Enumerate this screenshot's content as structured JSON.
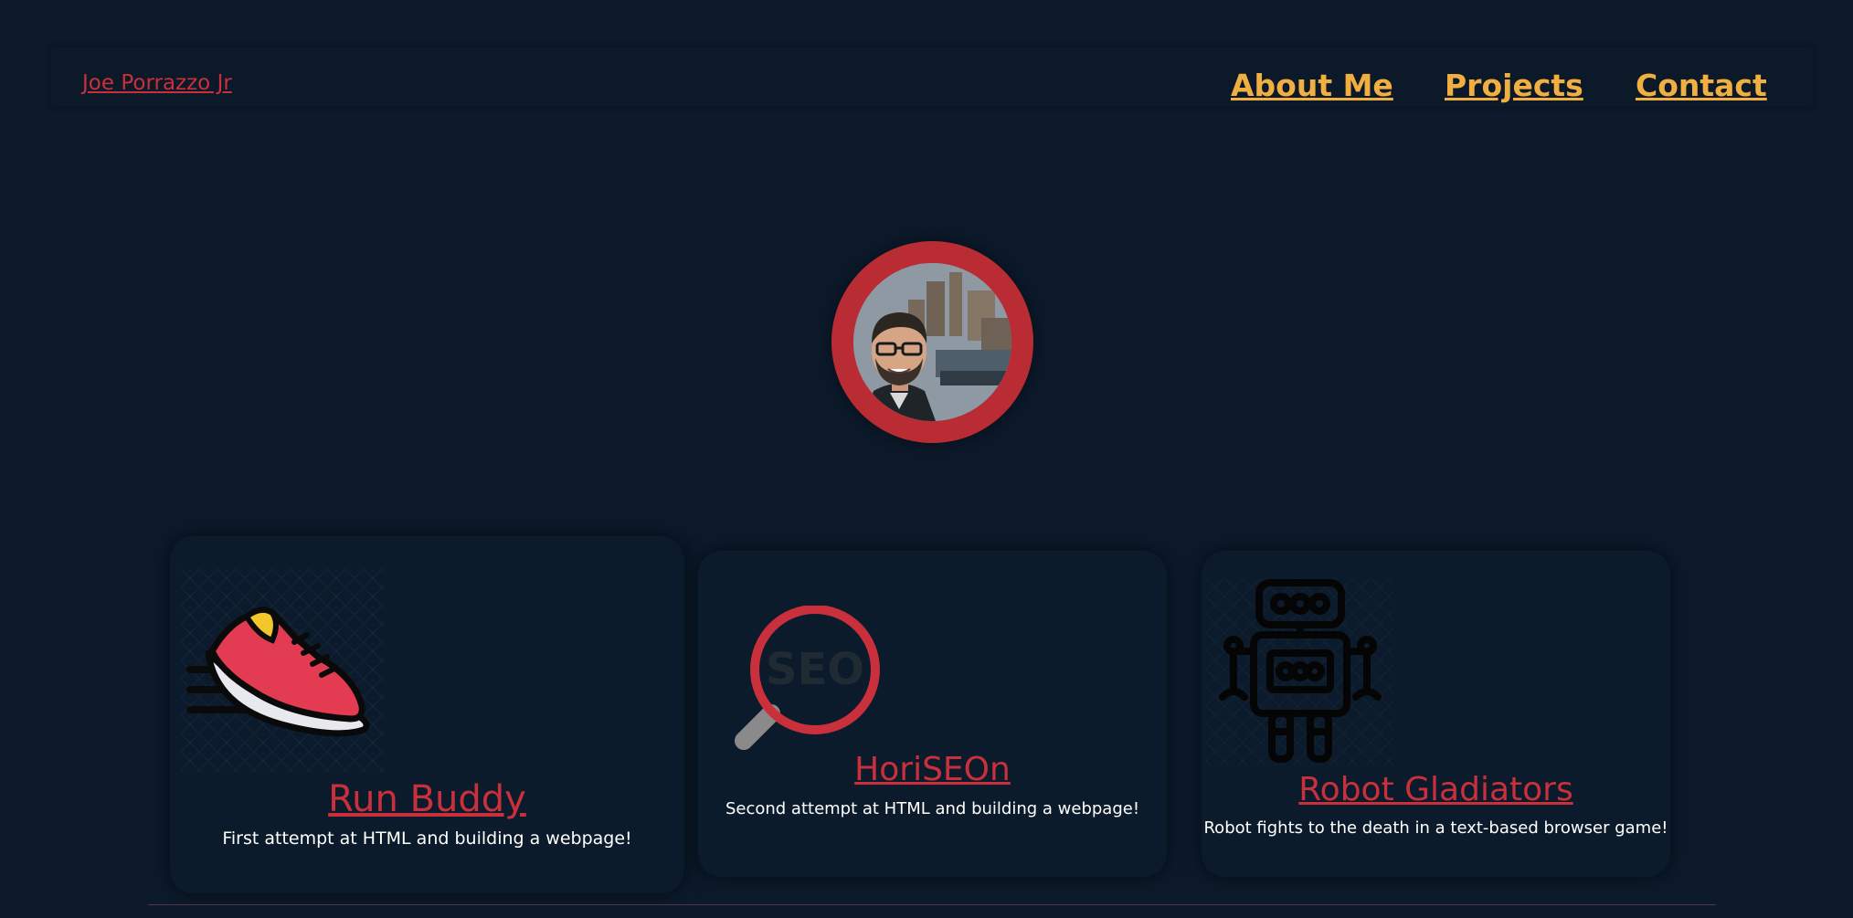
{
  "header": {
    "brand": "Joe Porrazzo Jr",
    "nav": [
      {
        "label": "About Me"
      },
      {
        "label": "Projects"
      },
      {
        "label": "Contact"
      }
    ]
  },
  "hero": {
    "avatar_icon": "profile-photo"
  },
  "projects": [
    {
      "title": "Run Buddy",
      "description": "First attempt at HTML and building a webpage!",
      "icon": "running-shoe-icon"
    },
    {
      "title": "HoriSEOn",
      "description": "Second attempt at HTML and building a webpage!",
      "icon": "seo-magnifier-icon",
      "icon_text": "SEO"
    },
    {
      "title": "Robot Gladiators",
      "description": "Robot fights to the death in a text-based browser game!",
      "icon": "robot-icon"
    }
  ],
  "colors": {
    "background": "#0c1a2b",
    "accent_red": "#c9303c",
    "accent_orange": "#f1ae41",
    "text": "#ffffff"
  }
}
